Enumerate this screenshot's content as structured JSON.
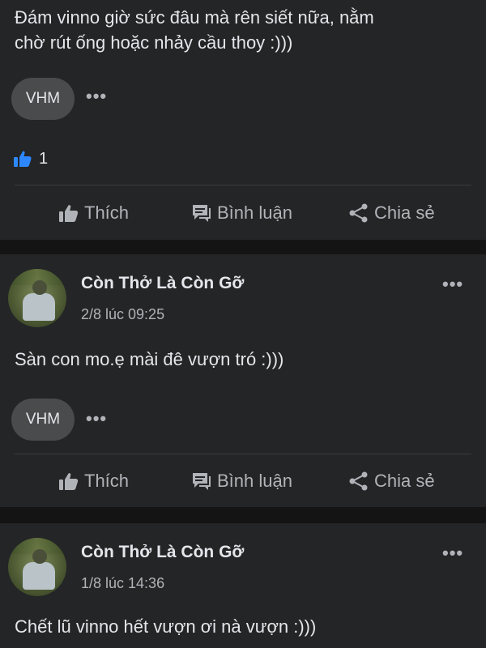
{
  "posts": [
    {
      "text_line1": "Đám vinno giờ sức đâu mà rên siết nữa, nằm",
      "text_line2": "chờ rút ống hoặc nhảy cầu thoy :)))",
      "tag": "VHM",
      "like_count": "1"
    },
    {
      "author": "Còn Thở Là Còn Gỡ",
      "timestamp": "2/8 lúc 09:25",
      "text": "Sàn con mo.ẹ mài đê vượn tró :)))",
      "tag": "VHM"
    },
    {
      "author": "Còn Thở Là Còn Gỡ",
      "timestamp": "1/8 lúc 14:36",
      "text": "Chết lũ vinno hết vượn ơi nà vượn :)))"
    }
  ],
  "actions": {
    "like": "Thích",
    "comment": "Bình luận",
    "share": "Chia sẻ"
  },
  "more_symbol": "•••",
  "colors": {
    "background": "#141414",
    "card": "#242526",
    "text": "#e4e6eb",
    "muted": "#b0b3b8",
    "like_blue": "#2d88ff"
  },
  "icons": [
    "thumbs-up-icon",
    "comment-icon",
    "share-icon",
    "more-icon",
    "like-reaction-icon"
  ]
}
